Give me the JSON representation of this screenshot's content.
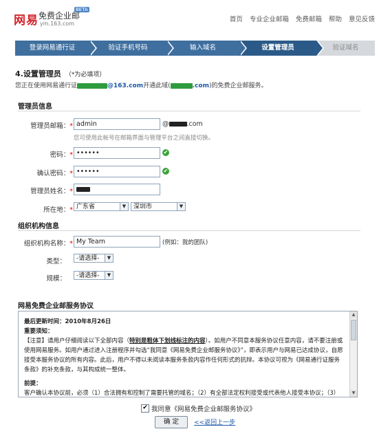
{
  "header": {
    "logo_net": "网易",
    "logo_title": "免费企业邮",
    "beta": "BETA",
    "domain": "ym.163.com",
    "nav": [
      "首页",
      "专业企业邮箱",
      "免费邮箱",
      "帮助",
      "意见反馈"
    ]
  },
  "steps": [
    {
      "label": "登录网易通行证",
      "state": "done"
    },
    {
      "label": "验证手机号码",
      "state": "done"
    },
    {
      "label": "输入域名",
      "state": "done"
    },
    {
      "label": "设置管理员",
      "state": "active"
    },
    {
      "label": "验证域名",
      "state": "todo"
    }
  ],
  "page": {
    "heading": "4.设置管理员",
    "required_note": "（*为必填项）",
    "intro_prefix": "您正在使用网易通行证",
    "intro_account_suffix": "@163.com",
    "intro_middle": "开通此域(",
    "intro_domain_suffix": ".com",
    "intro_end": ")的免费企业邮服务。"
  },
  "admin_section": {
    "title": "管理员信息",
    "email_label": "管理员邮箱：",
    "email_value": "admin",
    "email_at": "@",
    "email_domain_suffix": ".com",
    "email_hint": "您可使用此帐号在邮箱界面与管理平台之间直接切换。",
    "password_label": "密码：",
    "password_value": "••••••",
    "confirm_label": "确认密码：",
    "confirm_value": "••••••",
    "name_label": "管理员姓名：",
    "location_label": "所在地：",
    "province": "广东省",
    "city": "深圳市",
    "asterisk": "*",
    "check": "✔",
    "arrow": "▼"
  },
  "org_section": {
    "title": "组织机构信息",
    "org_label": "组织机构名称：",
    "org_value": "My Team",
    "org_hint": "(例如：我的团队)",
    "type_label": "类型：",
    "type_value": "-请选择-",
    "scale_label": "规模：",
    "scale_value": "-请选择-"
  },
  "agreement": {
    "title": "网易免费企业邮服务协议",
    "updated": "最后更新时间：2010年8月26日",
    "notice": "重要须知：",
    "para1_a": "【注意】请用户仔细阅读以下全部内容（",
    "para1_u": "特别是粗体下划线标注的内容",
    "para1_b": "）。如用户不同意本服务协议任意内容，请不要注册或使用网易服务。如用户通过进入注册程序并勾选“我同意《网易免费企业邮服务协议》”，即表示用户与网易已达成协议，自愿接受本服务协议的所有内容。此后，用户不得以未阅读本服务条款内容作任何形式的抗辩。本协议可视为《网易通行证服务条款》的补充条款，与其构成统一整体。",
    "preface_title": "前提：",
    "preface_text": "客户确认本协议前，必须（1）合法拥有和控制了需要托管的域名；（2）有全部法定权利接受或代表他人接受本协议；（3）阅读并",
    "scroll_up": "▲",
    "scroll_down": "▼"
  },
  "footer": {
    "agree_checkbox": "✔",
    "agree_label": "我同意《网易免费企业邮服务协议》",
    "ok_button": "确 定",
    "back_link": "<<返回上一步"
  }
}
